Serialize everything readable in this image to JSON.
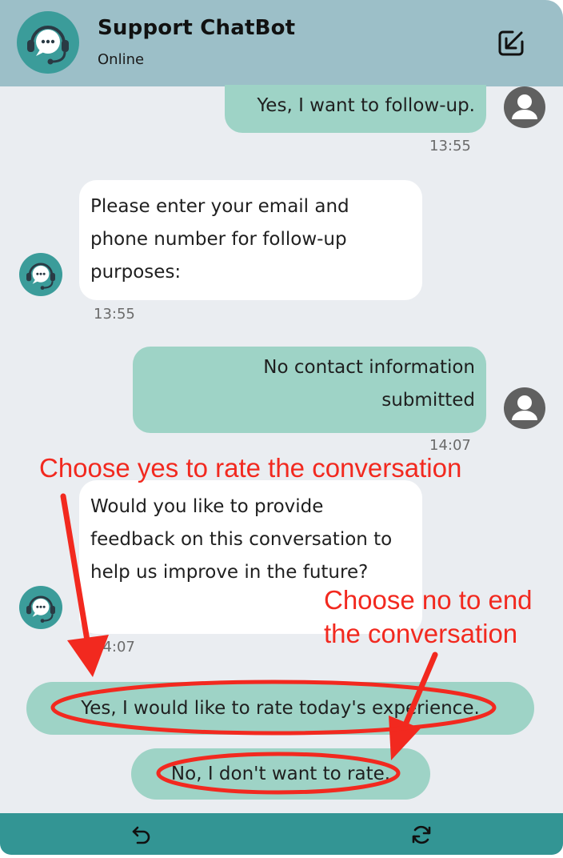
{
  "header": {
    "title": "Support ChatBot",
    "status": "Online",
    "icons": {
      "bot_avatar": "chat-bot-headset-icon",
      "minimize": "minimize-arrow-icon"
    }
  },
  "messages": [
    {
      "sender": "user",
      "text": "Yes, I want to follow-up.",
      "time": "13:55"
    },
    {
      "sender": "bot",
      "text": "Please enter your email and phone number for follow-up purposes:",
      "time": "13:55"
    },
    {
      "sender": "user",
      "text": "No contact information submitted",
      "time": "14:07"
    },
    {
      "sender": "bot",
      "text": "Would you like to provide feedback on this conversation to help us improve in the future?",
      "time": "14:07"
    }
  ],
  "quick_replies": [
    {
      "label": "Yes, I would like to rate today's experience."
    },
    {
      "label": "No, I don't want to rate."
    }
  ],
  "footer": {
    "icons": [
      "undo-arrow-icon",
      "refresh-icon"
    ]
  },
  "annotations": {
    "yes_note": "Choose yes to rate the conversation",
    "no_note_line1": "Choose no to end",
    "no_note_line2": "the conversation",
    "color": "#f2291f"
  },
  "colors": {
    "header": "#9cbfc8",
    "chat_background": "#eaedf1",
    "user_bubble": "#9ed3c6",
    "bot_bubble": "#ffffff",
    "bot_avatar": "#3b9c9a",
    "footer": "#339594"
  }
}
